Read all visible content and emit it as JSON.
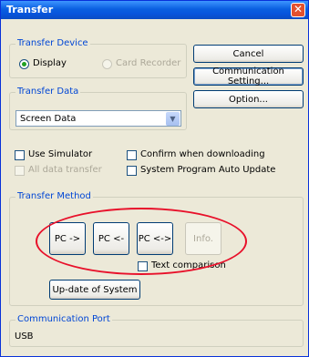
{
  "window": {
    "title": "Transfer",
    "close_symbol": "✕"
  },
  "transfer_device": {
    "label": "Transfer Device",
    "options": [
      {
        "label": "Display",
        "selected": true,
        "enabled": true
      },
      {
        "label": "Card Recorder",
        "selected": false,
        "enabled": false
      }
    ]
  },
  "buttons": {
    "cancel": "Cancel",
    "communication_setting": "Communication Setting...",
    "option": "Option..."
  },
  "transfer_data": {
    "label": "Transfer Data",
    "value": "Screen Data"
  },
  "checkboxes": {
    "use_simulator": "Use Simulator",
    "all_data_transfer": "All data transfer",
    "confirm_when_downloading": "Confirm when downloading",
    "system_program_auto_update": "System Program Auto Update"
  },
  "transfer_method": {
    "label": "Transfer Method",
    "pc_to": "PC ->",
    "pc_from": "PC <-",
    "pc_both": "PC <->",
    "info": "Info.",
    "text_comparison": "Text comparison",
    "update_system": "Up-date of System"
  },
  "communication_port": {
    "label": "Communication Port",
    "value": "USB"
  },
  "colors": {
    "title_bar": "#0a5fe0",
    "group_label": "#0046d5",
    "highlight_ellipse": "#e8102a"
  }
}
